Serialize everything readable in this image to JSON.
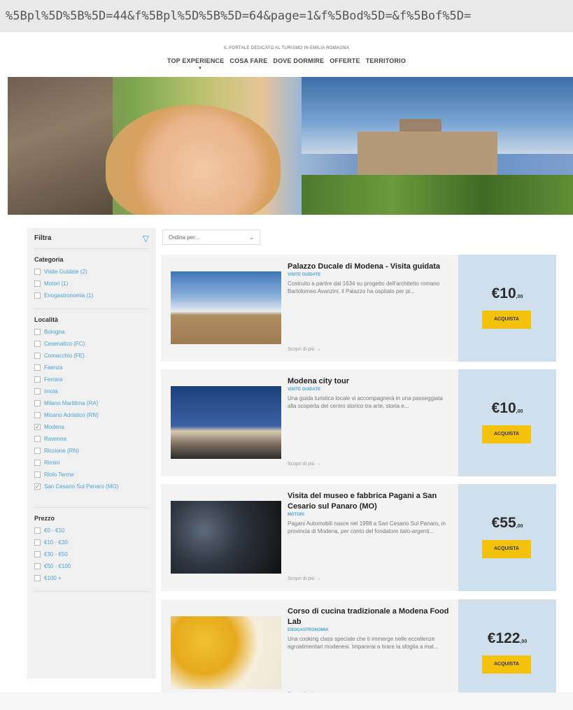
{
  "browser": {
    "url": "%5Bpl%5D%5B%5D=44&f%5Bpl%5D%5B%5D=64&page=1&f%5Bod%5D=&f%5Bof%5D="
  },
  "header": {
    "tagline": "IL PORTALE DEDICATO AL TURISMO IN EMILIA ROMAGNA",
    "nav": [
      "TOP EXPERIENCE",
      "COSA FARE",
      "DOVE DORMIRE",
      "OFFERTE",
      "TERRITORIO"
    ]
  },
  "sidebar": {
    "title": "Filtra",
    "sections": [
      {
        "title": "Categoria",
        "options": [
          {
            "label": "Visite Guidate (2)",
            "checked": false
          },
          {
            "label": "Motori (1)",
            "checked": false
          },
          {
            "label": "Enogastronomia (1)",
            "checked": false
          }
        ]
      },
      {
        "title": "Località",
        "options": [
          {
            "label": "Bologna",
            "checked": false
          },
          {
            "label": "Cesenatico (FC)",
            "checked": false
          },
          {
            "label": "Comacchio (FE)",
            "checked": false
          },
          {
            "label": "Faenza",
            "checked": false
          },
          {
            "label": "Ferrara",
            "checked": false
          },
          {
            "label": "Imola",
            "checked": false
          },
          {
            "label": "Milano Marittima (RA)",
            "checked": false
          },
          {
            "label": "Misano Adriatico (RN)",
            "checked": false
          },
          {
            "label": "Modena",
            "checked": true
          },
          {
            "label": "Ravenna",
            "checked": false
          },
          {
            "label": "Riccione (RN)",
            "checked": false
          },
          {
            "label": "Rimini",
            "checked": false
          },
          {
            "label": "Riolo Terme",
            "checked": false
          },
          {
            "label": "San Cesario Sul Panaro (MO)",
            "checked": true
          }
        ]
      },
      {
        "title": "Prezzo",
        "options": [
          {
            "label": "€0 - €10",
            "checked": false
          },
          {
            "label": "€10 - €30",
            "checked": false
          },
          {
            "label": "€30 - €50",
            "checked": false
          },
          {
            "label": "€50 - €100",
            "checked": false
          },
          {
            "label": "€100 +",
            "checked": false
          }
        ]
      }
    ]
  },
  "sort": {
    "label": "Ordina per..."
  },
  "cards": [
    {
      "title": "Palazzo Ducale di Modena - Visita guidata",
      "category": "VISITE GUIDATE",
      "description": "Costruito a partire dal 1634 su progetto dell'architetto romano Bartolomeo Avanzini, il Palazzo ha ospitato per pi...",
      "more": "Scopri di più →",
      "price": "€10",
      "cents": ",00",
      "button": "ACQUISTA"
    },
    {
      "title": "Modena city tour",
      "category": "VISITE GUIDATE",
      "description": "Una guida turistica locale vi accompagnerà in una passeggiata alla scoperta del centro storico tra arte, storia e...",
      "more": "Scopri di più →",
      "price": "€10",
      "cents": ",00",
      "button": "ACQUISTA"
    },
    {
      "title": "Visita del museo e fabbrica Pagani a San Cesario sul Panaro (MO)",
      "category": "MOTORI",
      "description": "Pagani Automobili nasce nel 1998 a San Cesario Sul Panaro, in provincia di Modena, per conto del fondatore italo-argenti...",
      "more": "Scopri di più →",
      "price": "€55",
      "cents": ",00",
      "button": "ACQUISTA"
    },
    {
      "title": "Corso di cucina tradizionale a Modena Food Lab",
      "category": "ENOGASTRONOMIA",
      "description": "Una cooking class speciale che ti immerge nelle eccellenze agroalimentari modenesi. Imparerai a tirare la sfoglia a mat...",
      "more": "Scopri di più →",
      "price": "€122",
      "cents": ",00",
      "button": "ACQUISTA"
    }
  ],
  "colors": {
    "accent": "#4aa3d6",
    "buy_button": "#f4c20d",
    "price_panel": "#cfe0ec",
    "card_bg": "#f3f3f3",
    "sidebar_bg": "#f0f0f0"
  }
}
